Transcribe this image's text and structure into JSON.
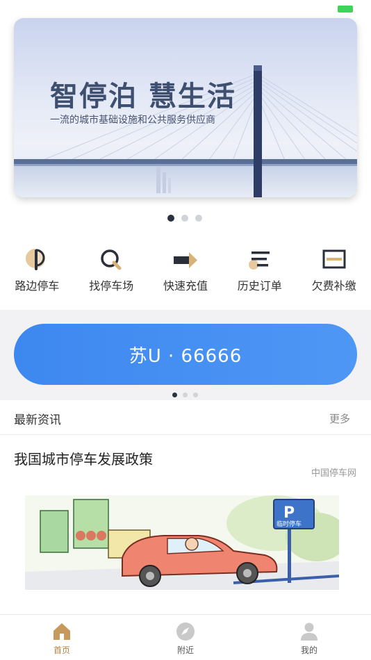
{
  "status_bar": {
    "battery_color": "#3ed35a"
  },
  "banner": {
    "title": "智停泊 慧生活",
    "subtitle": "一流的城市基础设施和公共服务供应商",
    "page_count": 3,
    "active_page": 1
  },
  "quick_actions": [
    {
      "label": "路边停车",
      "icon": "roadside-parking-icon"
    },
    {
      "label": "找停车场",
      "icon": "find-parking-icon"
    },
    {
      "label": "快速充值",
      "icon": "quick-recharge-icon"
    },
    {
      "label": "历史订单",
      "icon": "history-order-icon"
    },
    {
      "label": "欠费补缴",
      "icon": "arrears-payment-icon"
    }
  ],
  "plate": {
    "text": "苏U · 66666",
    "page_count": 3,
    "active_page": 1
  },
  "news": {
    "section_title": "最新资讯",
    "more_label": "更多",
    "articles": [
      {
        "title": "我国城市停车发展政策",
        "source": "中国停车网",
        "image_sign_text": "临时停车"
      }
    ]
  },
  "tabbar": {
    "tabs": [
      {
        "label": "首页",
        "icon": "home-icon",
        "active": true
      },
      {
        "label": "附近",
        "icon": "compass-icon",
        "active": false
      },
      {
        "label": "我的",
        "icon": "user-icon",
        "active": false
      }
    ],
    "active_color": "#b08040"
  },
  "colors": {
    "accent": "#3d88f0",
    "icon_gold": "#d9b27a",
    "icon_dark": "#2a2f3a"
  }
}
